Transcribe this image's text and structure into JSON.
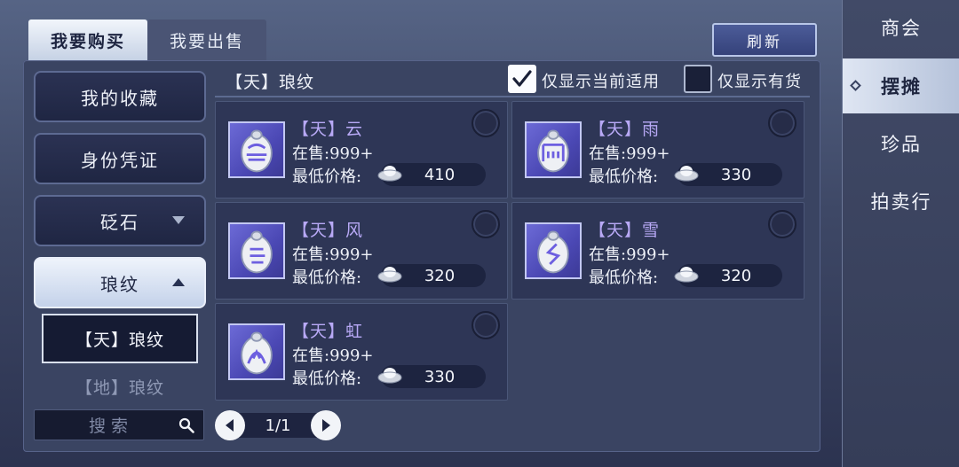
{
  "tabs": {
    "buy": "我要购买",
    "sell": "我要出售"
  },
  "refresh_label": "刷新",
  "right_nav": [
    "商会",
    "摆摊",
    "珍品",
    "拍卖行"
  ],
  "categories": {
    "favorites": "我的收藏",
    "credentials": "身份凭证",
    "stones": "砭石",
    "patterns": "琅纹",
    "sub_tian": "【天】琅纹",
    "sub_di": "【地】琅纹"
  },
  "search": {
    "placeholder": "搜索"
  },
  "pager": {
    "text": "1/1"
  },
  "section_title": "【天】琅纹",
  "filters": {
    "applicable_only": "仅显示当前适用",
    "in_stock_only": "仅显示有货"
  },
  "items": [
    {
      "name": "【天】云",
      "stock": "在售:999+",
      "price_label": "最低价格:",
      "price": "410",
      "glyph": "cloud"
    },
    {
      "name": "【天】雨",
      "stock": "在售:999+",
      "price_label": "最低价格:",
      "price": "330",
      "glyph": "rain"
    },
    {
      "name": "【天】风",
      "stock": "在售:999+",
      "price_label": "最低价格:",
      "price": "320",
      "glyph": "wind"
    },
    {
      "name": "【天】雪",
      "stock": "在售:999+",
      "price_label": "最低价格:",
      "price": "320",
      "glyph": "snow"
    },
    {
      "name": "【天】虹",
      "stock": "在售:999+",
      "price_label": "最低价格:",
      "price": "330",
      "glyph": "rainbow"
    }
  ],
  "colors": {
    "accent": "#b8a9f6",
    "panel": "#3a4462",
    "card": "#2e3656"
  }
}
